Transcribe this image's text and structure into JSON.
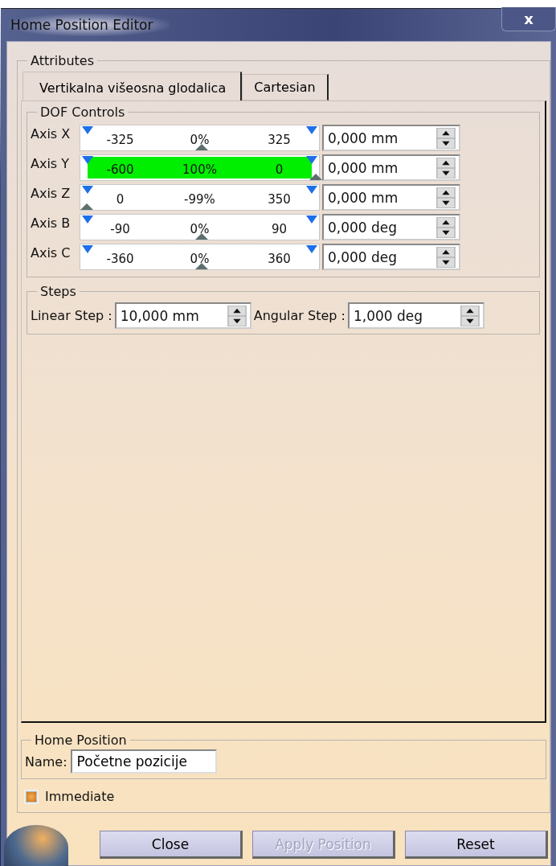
{
  "window": {
    "title": "Home Position Editor",
    "close": "x"
  },
  "attributes": {
    "title": "Attributes",
    "tabs": [
      {
        "label": "Vertikalna višeosna glodalica",
        "selected": true
      },
      {
        "label": "Cartesian",
        "selected": false
      }
    ],
    "dof_controls": {
      "title": "DOF Controls",
      "axes": [
        {
          "label": "Axis X",
          "min": "-325",
          "percent": "0%",
          "max": "325",
          "level": 0.5,
          "highlighted": false,
          "value": "0,000 mm"
        },
        {
          "label": "Axis Y",
          "min": "-600",
          "percent": "100%",
          "max": "0",
          "level": 1,
          "highlighted": true,
          "value": "0,000 mm"
        },
        {
          "label": "Axis Z",
          "min": "0",
          "percent": "-99%",
          "max": "350",
          "level": 0,
          "highlighted": false,
          "value": "0,000 mm"
        },
        {
          "label": "Axis B",
          "min": "-90",
          "percent": "0%",
          "max": "90",
          "level": 0.5,
          "highlighted": false,
          "value": "0,000 deg"
        },
        {
          "label": "Axis C",
          "min": "-360",
          "percent": "0%",
          "max": "360",
          "level": 0.5,
          "highlighted": false,
          "value": "0,000 deg"
        }
      ]
    },
    "steps": {
      "title": "Steps",
      "linear_label": "Linear Step :",
      "linear_value": "10,000 mm",
      "angular_label": "Angular Step :",
      "angular_value": "1,000 deg"
    }
  },
  "home_position": {
    "title": "Home Position",
    "name_label": "Name:",
    "name_value": "Početne pozicije"
  },
  "immediate": {
    "label": "Immediate",
    "checked": true
  },
  "buttons": [
    {
      "label": "Close",
      "disabled": false
    },
    {
      "label": "Apply Position",
      "disabled": true
    },
    {
      "label": "Reset",
      "disabled": false
    }
  ]
}
